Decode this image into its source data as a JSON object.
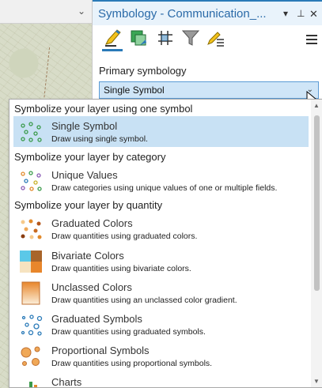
{
  "pane": {
    "title": "Symbology - Communication_...",
    "dropdown_glyph": "▾",
    "pin_glyph": "⊥",
    "close_glyph": "✕"
  },
  "toolbar": {
    "icons": [
      "primary-symbology-icon",
      "vary-symbology-icon",
      "symbol-layer-drawing-icon",
      "filter-icon",
      "label-classes-icon"
    ],
    "menu_icon": "hamburger-menu-icon"
  },
  "primary": {
    "label": "Primary symbology",
    "selected_value": "Single Symbol",
    "arrow": "⌄"
  },
  "dropdown": {
    "groups": [
      {
        "header": "Symbolize your layer using one symbol"
      },
      {
        "header": "Symbolize your layer by category"
      },
      {
        "header": "Symbolize your layer by quantity"
      }
    ],
    "options": [
      {
        "title": "Single Symbol",
        "desc": "Draw using single symbol.",
        "icon": "single-symbol-icon",
        "selected": true
      },
      {
        "title": "Unique Values",
        "desc": "Draw categories using unique values of one or multiple fields.",
        "icon": "unique-values-icon"
      },
      {
        "title": "Graduated Colors",
        "desc": "Draw quantities using graduated colors.",
        "icon": "graduated-colors-icon"
      },
      {
        "title": "Bivariate Colors",
        "desc": "Draw quantities using bivariate colors.",
        "icon": "bivariate-colors-icon"
      },
      {
        "title": "Unclassed Colors",
        "desc": "Draw quantities using an unclassed color gradient.",
        "icon": "unclassed-colors-icon"
      },
      {
        "title": "Graduated Symbols",
        "desc": "Draw quantities using graduated symbols.",
        "icon": "graduated-symbols-icon"
      },
      {
        "title": "Proportional Symbols",
        "desc": "Draw quantities using proportional symbols.",
        "icon": "proportional-symbols-icon"
      },
      {
        "title": "Charts",
        "desc": "",
        "icon": "charts-icon"
      }
    ],
    "scroll_up": "▲",
    "scroll_down": "▼"
  },
  "colors": {
    "accent": "#2a7ab8",
    "selected_bg": "#c8e1f4",
    "title_text": "#2a6aa8"
  }
}
